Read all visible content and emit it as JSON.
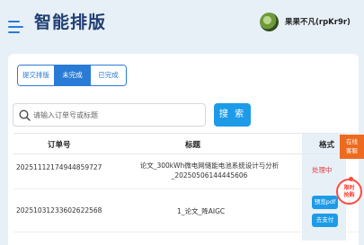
{
  "header": {
    "brand": "智能排版",
    "username": "果果不凡(rpKr9r)"
  },
  "tabs": [
    {
      "label": "提交排版",
      "active": false
    },
    {
      "label": "未完成",
      "active": true
    },
    {
      "label": "已完成",
      "active": false
    }
  ],
  "search": {
    "placeholder": "请输入订单号或标题",
    "button_label": "搜 索"
  },
  "table": {
    "columns": [
      "订单号",
      "标题",
      "格式"
    ],
    "rows": [
      {
        "order_no": "20251112174944859727",
        "title_line1": "论文_300kWh微电网储能电池系统设计与分析",
        "title_line2": "_20250506144445606",
        "status": "处理中",
        "actions": []
      },
      {
        "order_no": "20251031233602622568",
        "title_line1": "1_论文_降AIGC",
        "title_line2": "",
        "status": "",
        "actions": [
          "预览pdf",
          "去支付"
        ]
      }
    ]
  },
  "side": {
    "customer_service": [
      "在线",
      "客服"
    ],
    "promo": [
      "限时",
      "抢购"
    ]
  },
  "colors": {
    "accent": "#1e9be8",
    "brand_text": "#1f3e72",
    "status_red": "#e0393e",
    "service_orange": "#ee6a1f"
  }
}
